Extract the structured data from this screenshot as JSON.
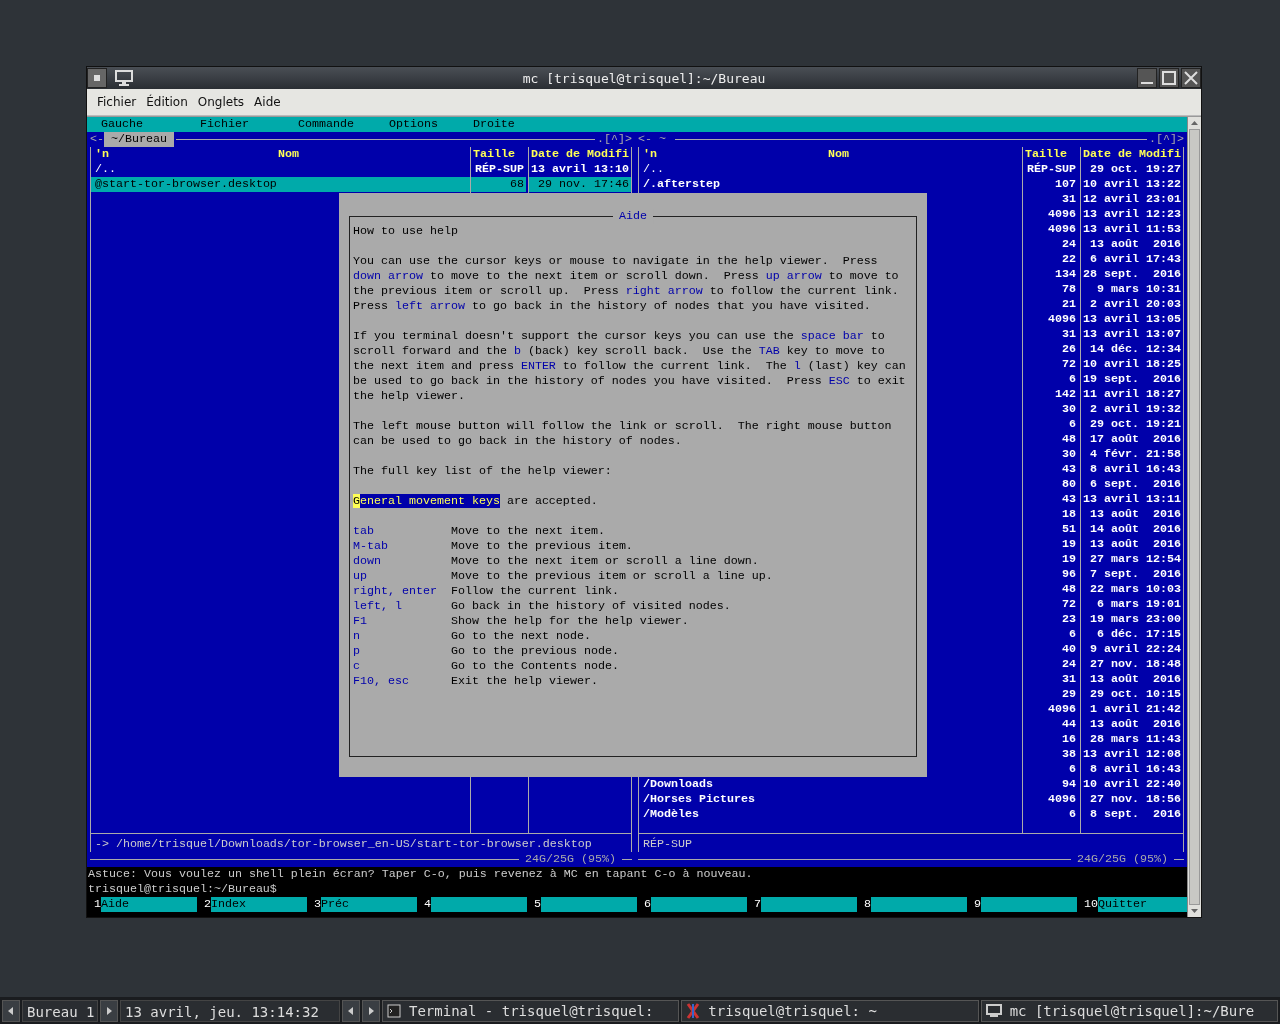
{
  "window": {
    "title": "mc [trisquel@trisquel]:~/Bureau"
  },
  "menubar": [
    "Fichier",
    "Édition",
    "Onglets",
    "Aide"
  ],
  "mc_menu": [
    "Gauche",
    "Fichier",
    "Commande",
    "Options",
    "Droite"
  ],
  "panels": [
    {
      "path": "~/Bureau",
      "active": true,
      "nav_left": "<-",
      "nav_right": ".[^]>",
      "columns": [
        "'n",
        "Nom",
        "Taille",
        "Date de Modifi"
      ],
      "rows": [
        {
          "name": "/..",
          "kind": "updir",
          "size": "RÉP-SUP",
          "date": "13 avril 13:10",
          "selected": false
        },
        {
          "name": "@start-tor-browser.desktop",
          "kind": "file",
          "size": "68",
          "date": "29 nov. 17:46",
          "selected": true
        }
      ],
      "status": "-> /home/trisquel/Downloads/tor-browser_en-US/start-tor-browser.desktop",
      "disk": "24G/25G (95%)"
    },
    {
      "path": "~",
      "active": false,
      "nav_left": "<-",
      "nav_right": ".[^]>",
      "columns": [
        "'n",
        "Nom",
        "Taille",
        "Date de Modifi"
      ],
      "rows": [
        {
          "name": "/..",
          "kind": "updir",
          "size": "RÉP-SUP",
          "date": "29 oct. 19:27",
          "selected": false
        },
        {
          "name": "/.afterstep",
          "kind": "dir",
          "size": "107",
          "date": "10 avril 13:22",
          "selected": false
        },
        {
          "size": "31",
          "date": "12 avril 23:01",
          "selected": false
        },
        {
          "size": "4096",
          "date": "13 avril 12:23",
          "selected": false
        },
        {
          "size": "4096",
          "date": "13 avril 11:53",
          "selected": false
        },
        {
          "size": "24",
          "date": "13 août  2016",
          "selected": false
        },
        {
          "size": "22",
          "date": "6 avril 17:43",
          "selected": false
        },
        {
          "size": "134",
          "date": "28 sept.  2016",
          "selected": false
        },
        {
          "size": "78",
          "date": "9 mars 10:31",
          "selected": false
        },
        {
          "size": "21",
          "date": "2 avril 20:03",
          "selected": false
        },
        {
          "size": "4096",
          "date": "13 avril 13:05",
          "selected": false
        },
        {
          "size": "31",
          "date": "13 avril 13:07",
          "selected": false
        },
        {
          "size": "26",
          "date": "14 déc. 12:34",
          "selected": false
        },
        {
          "size": "72",
          "date": "10 avril 18:25",
          "selected": false
        },
        {
          "size": "6",
          "date": "19 sept.  2016",
          "selected": false
        },
        {
          "size": "142",
          "date": "11 avril 18:27",
          "selected": false
        },
        {
          "size": "30",
          "date": "2 avril 19:32",
          "selected": false
        },
        {
          "size": "6",
          "date": "29 oct. 19:21",
          "selected": false
        },
        {
          "size": "48",
          "date": "17 août  2016",
          "selected": false
        },
        {
          "size": "30",
          "date": "4 févr. 21:58",
          "selected": false
        },
        {
          "size": "43",
          "date": "8 avril 16:43",
          "selected": false
        },
        {
          "size": "80",
          "date": "6 sept.  2016",
          "selected": false
        },
        {
          "size": "43",
          "date": "13 avril 13:11",
          "selected": false
        },
        {
          "size": "18",
          "date": "13 août  2016",
          "selected": false
        },
        {
          "size": "51",
          "date": "14 août  2016",
          "selected": false
        },
        {
          "size": "19",
          "date": "13 août  2016",
          "selected": false
        },
        {
          "size": "19",
          "date": "27 mars 12:54",
          "selected": false
        },
        {
          "size": "96",
          "date": "7 sept.  2016",
          "selected": false
        },
        {
          "size": "48",
          "date": "22 mars 10:03",
          "selected": false
        },
        {
          "size": "72",
          "date": "6 mars 19:01",
          "selected": false
        },
        {
          "size": "23",
          "date": "19 mars 23:00",
          "selected": false
        },
        {
          "size": "6",
          "date": "6 déc. 17:15",
          "selected": false
        },
        {
          "size": "40",
          "date": "9 avril 22:24",
          "selected": false
        },
        {
          "size": "24",
          "date": "27 nov. 18:48",
          "selected": false
        },
        {
          "size": "31",
          "date": "13 août  2016",
          "selected": false
        },
        {
          "size": "29",
          "date": "29 oct. 10:15",
          "selected": false
        },
        {
          "size": "4096",
          "date": "1 avril 21:42",
          "selected": false
        },
        {
          "size": "44",
          "date": "13 août  2016",
          "selected": false
        },
        {
          "size": "16",
          "date": "28 mars 11:43",
          "selected": false
        },
        {
          "size": "38",
          "date": "13 avril 12:08",
          "selected": false
        },
        {
          "size": "6",
          "date": "8 avril 16:43",
          "selected": false
        },
        {
          "name": "/Downloads",
          "kind": "dir",
          "size": "94",
          "date": "10 avril 22:40",
          "selected": false
        },
        {
          "name": "/Horses Pictures",
          "kind": "dir",
          "size": "4096",
          "date": "27 nov. 18:56",
          "selected": false
        },
        {
          "name": "/Modèles",
          "kind": "dir",
          "size": "6",
          "date": "8 sept.  2016",
          "selected": false
        }
      ],
      "status": "RÉP-SUP",
      "disk": "24G/25G (95%)"
    }
  ],
  "help_dialog": {
    "title": "Aide",
    "paragraphs": [
      [
        [
          {
            "kind": "text",
            "text": "How to use help"
          }
        ]
      ],
      [
        [
          {
            "kind": "text",
            "text": "You can use the cursor keys or mouse to navigate in the help viewer.  Press"
          }
        ],
        [
          {
            "kind": "link",
            "text": "down arrow",
            "selected": false
          },
          {
            "kind": "text",
            "text": " to move to the next item or scroll down.  Press "
          },
          {
            "kind": "link",
            "text": "up arrow",
            "selected": false
          },
          {
            "kind": "text",
            "text": " to move to"
          }
        ],
        [
          {
            "kind": "text",
            "text": "the previous item or scroll up.  Press "
          },
          {
            "kind": "link",
            "text": "right arrow",
            "selected": false
          },
          {
            "kind": "text",
            "text": " to follow the current link."
          }
        ],
        [
          {
            "kind": "text",
            "text": "Press "
          },
          {
            "kind": "link",
            "text": "left arrow",
            "selected": false
          },
          {
            "kind": "text",
            "text": " to go back in the history of nodes that you have visited."
          }
        ]
      ],
      [
        [
          {
            "kind": "text",
            "text": "If you terminal doesn't support the cursor keys you can use the "
          },
          {
            "kind": "link",
            "text": "space bar",
            "selected": false
          },
          {
            "kind": "text",
            "text": " to"
          }
        ],
        [
          {
            "kind": "text",
            "text": "scroll forward and the "
          },
          {
            "kind": "link",
            "text": "b",
            "selected": false
          },
          {
            "kind": "text",
            "text": " (back) key scroll back.  Use the "
          },
          {
            "kind": "link",
            "text": "TAB",
            "selected": false
          },
          {
            "kind": "text",
            "text": " key to move to"
          }
        ],
        [
          {
            "kind": "text",
            "text": "the next item and press "
          },
          {
            "kind": "link",
            "text": "ENTER",
            "selected": false
          },
          {
            "kind": "text",
            "text": " to follow the current link.  The "
          },
          {
            "kind": "link",
            "text": "l",
            "selected": false
          },
          {
            "kind": "text",
            "text": " (last) key can"
          }
        ],
        [
          {
            "kind": "text",
            "text": "be used to go back in the history of nodes you have visited.  Press "
          },
          {
            "kind": "link",
            "text": "ESC",
            "selected": false
          },
          {
            "kind": "text",
            "text": " to exit"
          }
        ],
        [
          {
            "kind": "text",
            "text": "the help viewer."
          }
        ]
      ],
      [
        [
          {
            "kind": "text",
            "text": "The left mouse button will follow the link or scroll.  The right mouse button"
          }
        ],
        [
          {
            "kind": "text",
            "text": "can be used to go back in the history of nodes."
          }
        ]
      ],
      [
        [
          {
            "kind": "text",
            "text": "The full key list of the help viewer:"
          }
        ]
      ],
      [
        [
          {
            "kind": "link",
            "text": "General movement keys",
            "selected": true
          },
          {
            "kind": "text",
            "text": " are accepted."
          }
        ]
      ]
    ],
    "keys": [
      {
        "key": "tab",
        "description": "Move to the next item."
      },
      {
        "key": "M-tab",
        "description": "Move to the previous item."
      },
      {
        "key": "down",
        "description": "Move to the next item or scroll a line down."
      },
      {
        "key": "up",
        "description": "Move to the previous item or scroll a line up."
      },
      {
        "key": "right, enter",
        "description": "Follow the current link."
      },
      {
        "key": "left, l",
        "description": "Go back in the history of visited nodes."
      },
      {
        "key": "F1",
        "description": "Show the help for the help viewer."
      },
      {
        "key": "n",
        "description": "Go to the next node."
      },
      {
        "key": "p",
        "description": "Go to the previous node."
      },
      {
        "key": "c",
        "description": "Go to the Contents node."
      },
      {
        "key": "F10, esc",
        "description": "Exit the help viewer."
      }
    ]
  },
  "hint": "Astuce: Vous voulez un shell plein écran? Taper C-o, puis revenez à MC en tapant C-o à nouveau.",
  "prompt": "trisquel@trisquel:~/Bureau$",
  "function_keys": [
    {
      "number": "1",
      "label": "Aide"
    },
    {
      "number": "2",
      "label": "Index"
    },
    {
      "number": "3",
      "label": "Préc"
    },
    {
      "number": "4"
    },
    {
      "number": "5"
    },
    {
      "number": "6"
    },
    {
      "number": "7"
    },
    {
      "number": "8"
    },
    {
      "number": "9"
    },
    {
      "number": "10",
      "label": "Quitter"
    }
  ],
  "taskbar": {
    "desktop": "Bureau 1",
    "clock": "13 avril, jeu. 13:14:32",
    "tasks": [
      {
        "title": "Terminal - trisquel@trisquel:"
      },
      {
        "title": "trisquel@trisquel: ~"
      },
      {
        "title": "mc [trisquel@trisquel]:~/Bure"
      }
    ]
  }
}
